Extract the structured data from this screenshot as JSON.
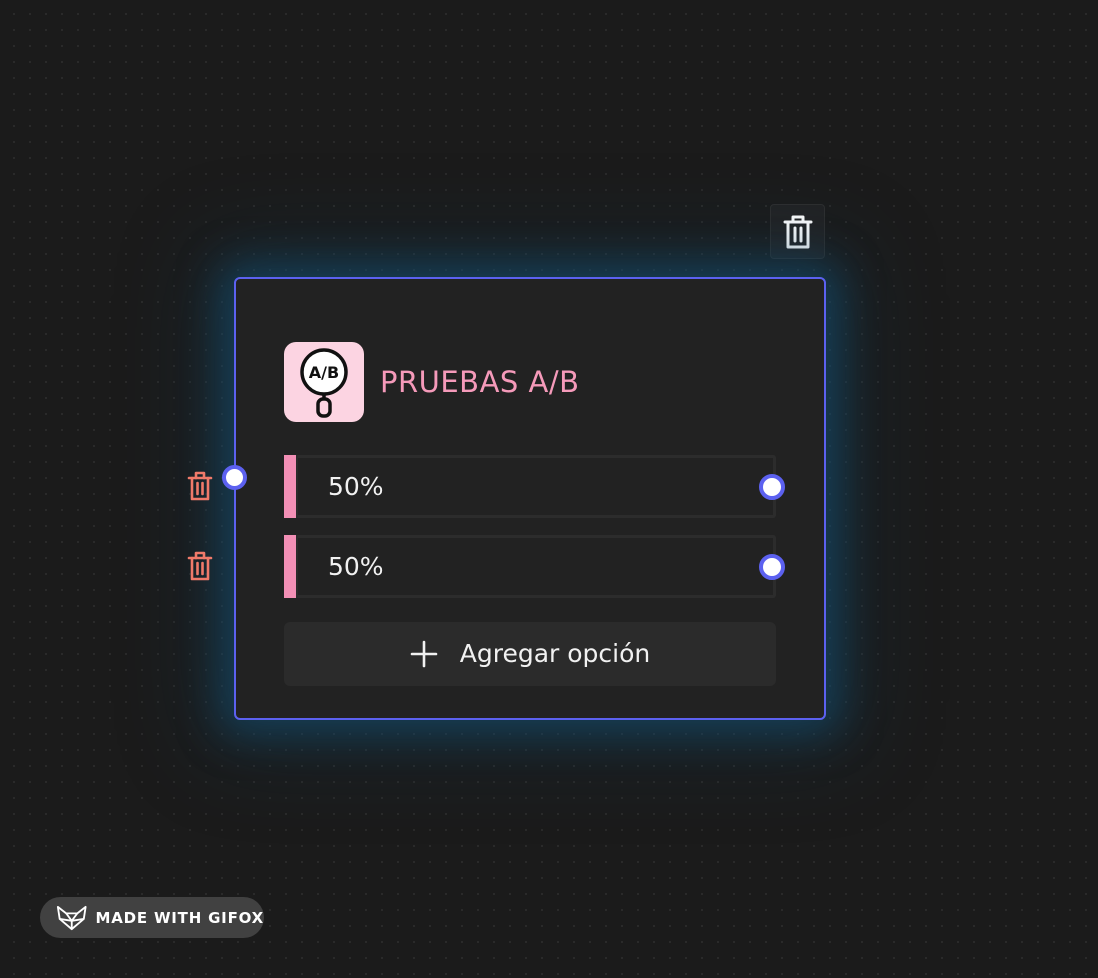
{
  "node": {
    "title": "PRUEBAS A/B",
    "icon": "ab-test-magnifier-icon",
    "icon_text": "A/B",
    "options": [
      {
        "value": "50%"
      },
      {
        "value": "50%"
      }
    ],
    "add_option_label": "Agregar opción"
  },
  "watermark": {
    "text": "MADE WITH GIFOX",
    "icon": "fox-logo-icon"
  },
  "colors": {
    "background": "#1b1b1b",
    "node_bg": "#222222",
    "node_border": "#5c61f0",
    "accent_pink": "#f28fb5",
    "title_pink": "#f59aba",
    "icon_bg": "#fcd4e2",
    "delete_red": "#f07a6a",
    "glow": "#12547a"
  }
}
